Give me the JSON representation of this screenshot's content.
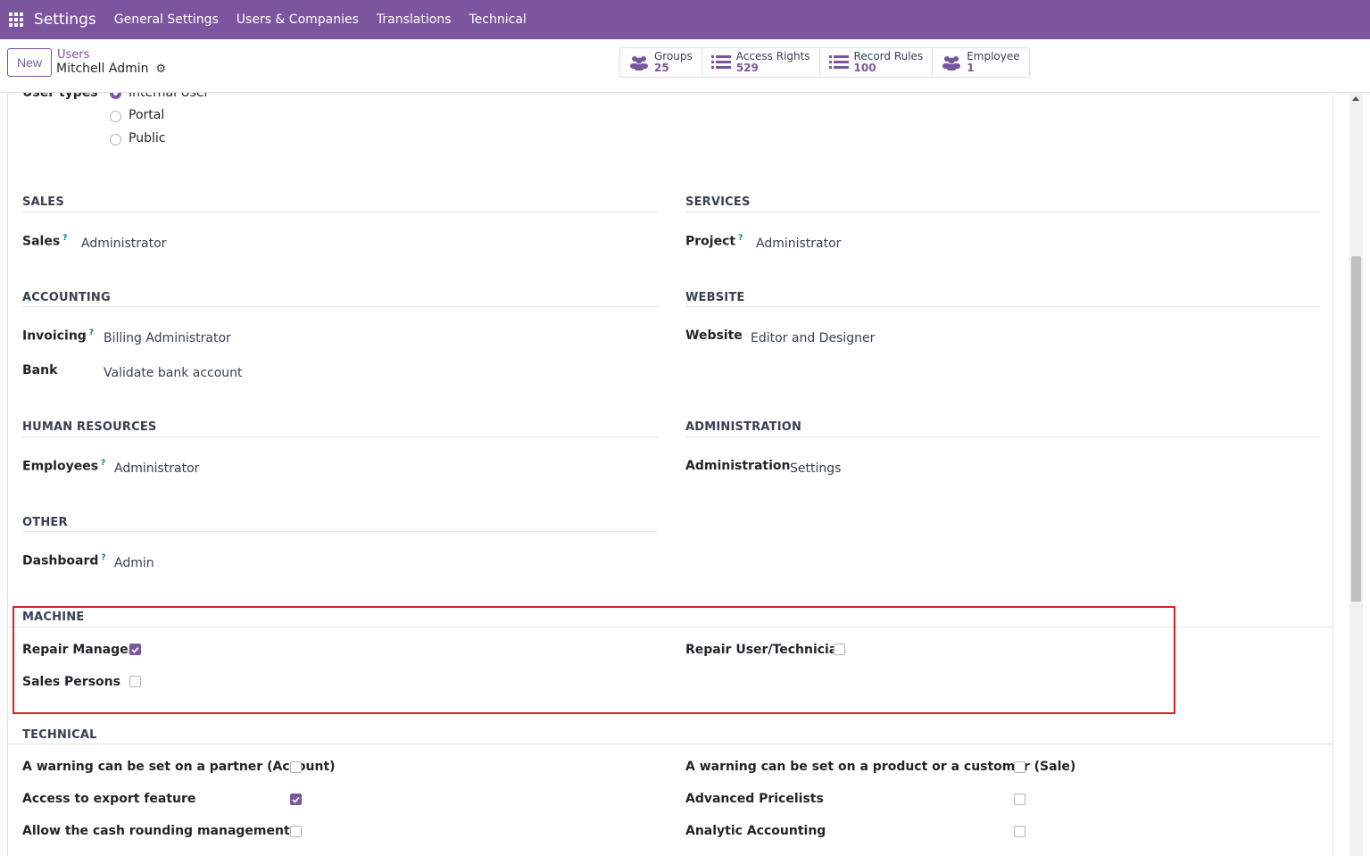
{
  "topbar": {
    "brand": "Settings",
    "menu": [
      "General Settings",
      "Users & Companies",
      "Translations",
      "Technical"
    ]
  },
  "control": {
    "new_label": "New",
    "breadcrumb_parent": "Users",
    "breadcrumb_current": "Mitchell Admin"
  },
  "smart_buttons": [
    {
      "label": "Groups",
      "value": "25",
      "icon": "users-icon"
    },
    {
      "label": "Access Rights",
      "value": "529",
      "icon": "list-icon"
    },
    {
      "label": "Record Rules",
      "value": "100",
      "icon": "list-icon"
    },
    {
      "label": "Employee",
      "value": "1",
      "icon": "users-icon"
    }
  ],
  "user_types": {
    "label": "User types",
    "options": [
      {
        "label": "Internal User",
        "selected": true
      },
      {
        "label": "Portal",
        "selected": false
      },
      {
        "label": "Public",
        "selected": false
      }
    ]
  },
  "sections": {
    "sales": {
      "title": "SALES",
      "field": "Sales",
      "value": "Administrator"
    },
    "services": {
      "title": "SERVICES",
      "field": "Project",
      "value": "Administrator"
    },
    "accounting": {
      "title": "ACCOUNTING",
      "field1": "Invoicing",
      "value1": "Billing Administrator",
      "field2": "Bank",
      "value2": "Validate bank account"
    },
    "website": {
      "title": "WEBSITE",
      "field": "Website",
      "value": "Editor and Designer"
    },
    "hr": {
      "title": "HUMAN RESOURCES",
      "field": "Employees",
      "value": "Administrator"
    },
    "administration": {
      "title": "ADMINISTRATION",
      "field": "Administration",
      "value": "Settings"
    },
    "other": {
      "title": "OTHER",
      "field": "Dashboard",
      "value": "Admin"
    },
    "machine": {
      "title": "MACHINE",
      "items": [
        {
          "label": "Repair Manager",
          "checked": true
        },
        {
          "label": "Repair User/Technician",
          "checked": false
        },
        {
          "label": "Sales Persons",
          "checked": false
        }
      ]
    },
    "technical": {
      "title": "TECHNICAL",
      "items": [
        {
          "label": "A warning can be set on a partner (Account)",
          "checked": false
        },
        {
          "label": "A warning can be set on a product or a customer (Sale)",
          "checked": false
        },
        {
          "label": "Access to export feature",
          "checked": true
        },
        {
          "label": "Advanced Pricelists",
          "checked": false
        },
        {
          "label": "Allow the cash rounding management",
          "checked": false
        },
        {
          "label": "Analytic Accounting",
          "checked": false
        }
      ]
    }
  },
  "colors": {
    "brand": "#7c559f",
    "highlight": "#d9212c",
    "help": "#017e84"
  }
}
